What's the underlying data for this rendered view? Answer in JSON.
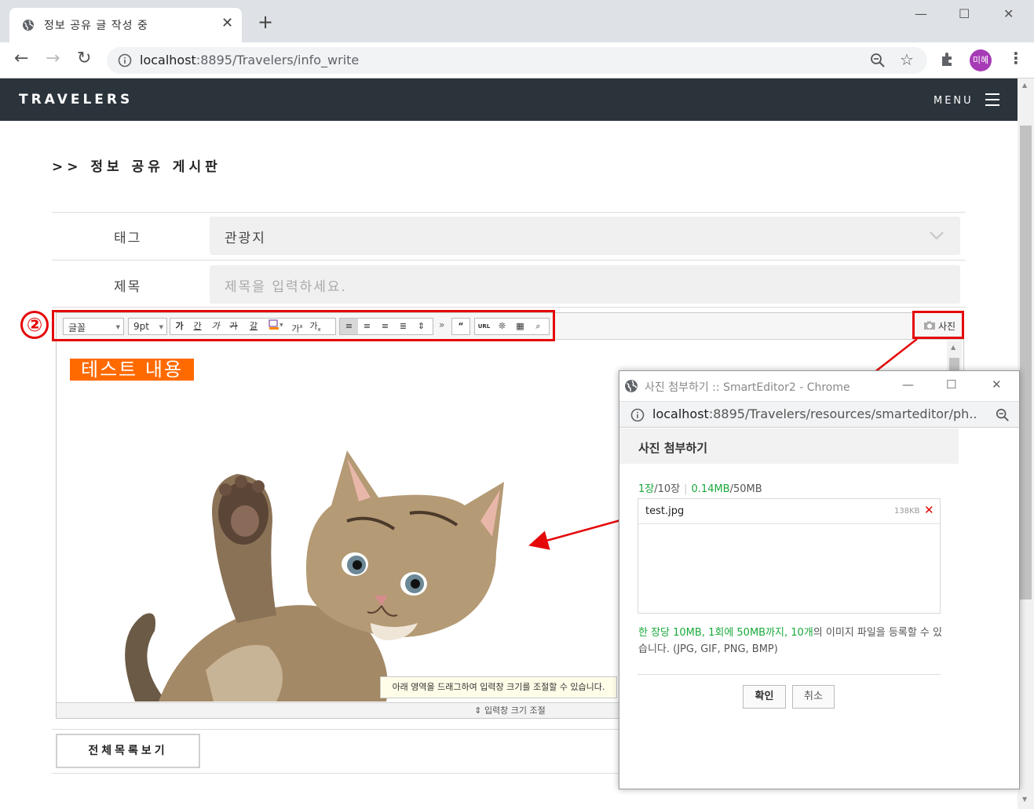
{
  "browser": {
    "tab_title": "정보 공유 글 작성 중",
    "url_host": "localhost",
    "url_rest": ":8895/Travelers/info_write",
    "avatar_label": "미혜"
  },
  "site": {
    "brand": "TRAVELERS",
    "menu_label": "MENU"
  },
  "board": {
    "title": ">> 정보 공유 게시판",
    "tag_label": "태그",
    "tag_value": "관광지",
    "subject_label": "제목",
    "subject_placeholder": "제목을 입력하세요."
  },
  "editor": {
    "font_select": "글꼴",
    "size_select": "9pt",
    "format_buttons": [
      "가",
      "간",
      "가",
      "가",
      "갈"
    ],
    "photo_button": "사진",
    "url_button": "URL",
    "content_text": "테스트 내용",
    "resize_tip": "아래 영역을 드래그하여 입력창 크기를 조절할 수 있습니다.",
    "resize_label": "입력창 크기 조절"
  },
  "list_button": "전체목록보기",
  "annotation": {
    "number": "②",
    "color": "#e4080a"
  },
  "popup": {
    "window_title": "사진 첨부하기 :: SmartEditor2 - Chrome",
    "url_host": "localhost",
    "url_rest": ":8895/Travelers/resources/smarteditor/ph...",
    "header": "사진 첨부하기",
    "count_current": "1장",
    "count_total": "/10장",
    "size_current": "0.14MB",
    "size_total": "/50MB",
    "file_name": "test.jpg",
    "file_size": "138KB",
    "note_green": "한 장당 10MB, 1회에 50MB까지, 10개",
    "note_rest": "의 이미지 파일을 등록할 수 있습니다. (JPG, GIF, PNG, BMP)",
    "confirm": "확인",
    "cancel": "취소"
  },
  "colors": {
    "navbar": "#2b333b",
    "highlight": "#ff6a00",
    "accent_green": "#18a93a",
    "annotation_red": "#e4080a"
  }
}
